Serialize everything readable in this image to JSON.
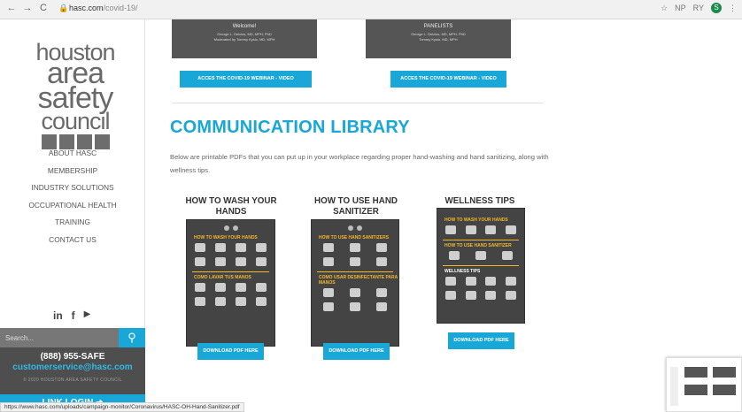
{
  "browser": {
    "back": "←",
    "forward": "→",
    "reload": "C",
    "lock": "🔒",
    "url_domain": "hasc.com",
    "url_path": "/covid-19/",
    "star": "☆",
    "ext1": "NP",
    "ext2": "RY",
    "profile": "S",
    "menu": "⋮"
  },
  "sidebar": {
    "logo": {
      "line1": "houston",
      "line2": "area",
      "line3": "safety",
      "line4": "council"
    },
    "menu": [
      {
        "label": "ABOUT HASC"
      },
      {
        "label": "MEMBERSHIP"
      },
      {
        "label": "INDUSTRY SOLUTIONS"
      },
      {
        "label": "OCCUPATIONAL HEALTH"
      },
      {
        "label": "TRAINING"
      },
      {
        "label": "CONTACT US"
      }
    ],
    "social": {
      "linkedin": "in",
      "facebook": "f",
      "youtube": "▶"
    },
    "search": {
      "placeholder": "Search...",
      "icon": "⚲"
    },
    "phone": "(888) 955-SAFE",
    "email": "customerservice@hasc.com",
    "copyright": "© 2020 HOUSTON AREA SAFETY COUNCIL",
    "login": "LINK LOGIN ➜"
  },
  "main": {
    "webinar_cards": [
      {
        "header": "Welcome!",
        "lines": [
          "George L. Delclos, MD, MPH, PhD",
          "Moderated by Tommy Kyslo, MD, MPH"
        ]
      },
      {
        "header": "PANELISTS",
        "lines": [
          "George L. Delclos, MD, MPH, PhD",
          "Tommy Kyslo, MD, MPH"
        ]
      }
    ],
    "webinar_buttons": [
      "ACCES THE COVID-19 WEBINAR - VIDEO",
      "ACCES THE COVID-19 WEBINAR - VIDEO"
    ],
    "heading": "COMMUNICATION LIBRARY",
    "intro": "Below are printable PDFs that you can put up in your workplace regarding proper hand-washing and hand sanitizing, along with wellness tips.",
    "posters": [
      {
        "title": "HOW TO WASH YOUR HANDS",
        "section1": "HOW TO WASH YOUR HANDS",
        "section2": "COMO LAVAR TUS MANOS",
        "button": "DOWNLOAD PDF HERE"
      },
      {
        "title": "HOW TO USE HAND SANITIZER",
        "section1": "HOW TO USE HAND SANITIZERS",
        "section2": "COMO USAR DESINFECTANTE PARA MANOS",
        "button": "DOWNLOAD PDF HERE"
      },
      {
        "title": "WELLNESS TIPS",
        "section1": "HOW TO WASH YOUR HANDS",
        "section2": "HOW TO USE HAND SANITIZER",
        "section3": "WELLNESS TIPS",
        "button": "DOWNLOAD PDF HERE"
      }
    ]
  },
  "status": {
    "url": "https://www.hasc.com/uploads/campaign-monitor/Coronavirus/HASC-OH-Hand-Sanitizer.pdf"
  },
  "colors": {
    "accent": "#18a7d6",
    "poster_bg": "#444444",
    "poster_text": "#f3b82b",
    "contact_bg": "#4e4e4e"
  }
}
